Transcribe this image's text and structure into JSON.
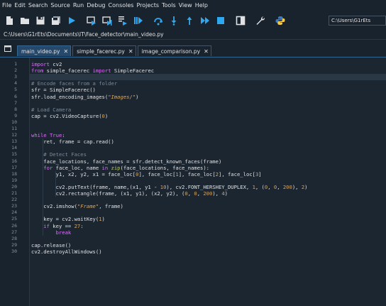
{
  "menu": {
    "items": [
      "File",
      "Edit",
      "Search",
      "Source",
      "Run",
      "Debug",
      "Consoles",
      "Projects",
      "Tools",
      "View",
      "Help"
    ]
  },
  "toolbar": {
    "buttons": [
      {
        "name": "new-file-icon"
      },
      {
        "name": "open-folder-icon"
      },
      {
        "name": "save-icon"
      },
      {
        "name": "save-all-icon"
      },
      {
        "name": "run-icon"
      },
      {
        "name": "run-cell-icon"
      },
      {
        "name": "run-cell-advance-icon"
      },
      {
        "name": "run-selection-icon"
      },
      {
        "name": "debug-icon"
      },
      {
        "name": "step-over-icon"
      },
      {
        "name": "step-into-icon"
      },
      {
        "name": "step-return-icon"
      },
      {
        "name": "continue-icon"
      },
      {
        "name": "stop-icon"
      },
      {
        "name": "maximize-pane-icon"
      },
      {
        "name": "preferences-icon"
      },
      {
        "name": "python-path-icon"
      }
    ],
    "cwd": "C:\\Users\\G1rEts"
  },
  "path": "C:\\Users\\G1rEts\\Documents\\IT\\Face_detector\\main_video.py",
  "tabs": [
    {
      "label": "main_video.py",
      "active": true
    },
    {
      "label": "simple_facerec.py",
      "active": false
    },
    {
      "label": "image_comparison.py",
      "active": false
    }
  ],
  "code": {
    "line_numbers": [
      "1",
      "2",
      "3",
      "4",
      "5",
      "6",
      "7",
      "8",
      "9",
      "10",
      "11",
      "12",
      "13",
      "14",
      "15",
      "16",
      "17",
      "18",
      "19",
      "20",
      "21",
      "22",
      "23",
      "24",
      "25",
      "26",
      "27",
      "28",
      "29",
      "30"
    ],
    "highlight_line": 3,
    "lines": [
      [
        [
          "kw",
          "import"
        ],
        [
          "op",
          " cv2"
        ]
      ],
      [
        [
          "kw",
          "from"
        ],
        [
          "op",
          " simple_facerec "
        ],
        [
          "kw",
          "import"
        ],
        [
          "op",
          " SimpleFacerec"
        ]
      ],
      [],
      [
        [
          "cm",
          "# Encode faces from a folder"
        ]
      ],
      [
        [
          "op",
          "sfr = SimpleFacerec()"
        ]
      ],
      [
        [
          "op",
          "sfr.load_encoding_images("
        ],
        [
          "st",
          "\"Images/\""
        ],
        [
          "op",
          ")"
        ]
      ],
      [],
      [
        [
          "cm",
          "# Load Camera"
        ]
      ],
      [
        [
          "op",
          "cap = cv2.VideoCapture("
        ],
        [
          "nm",
          "0"
        ],
        [
          "op",
          ")"
        ]
      ],
      [],
      [],
      [
        [
          "kw",
          "while"
        ],
        [
          "op",
          " "
        ],
        [
          "kw",
          "True"
        ],
        [
          "op",
          ":"
        ]
      ],
      [
        [
          "op",
          "    ret, frame = cap.read()"
        ]
      ],
      [],
      [
        [
          "cm",
          "    # Detect Faces"
        ]
      ],
      [
        [
          "op",
          "    face_locations, face_names = sfr.detect_known_faces(frame)"
        ]
      ],
      [
        [
          "kw",
          "    for"
        ],
        [
          "op",
          " face_loc, name "
        ],
        [
          "kw",
          "in"
        ],
        [
          "op",
          " "
        ],
        [
          "bi",
          "zip"
        ],
        [
          "op",
          "(face_locations, face_names):"
        ]
      ],
      [
        [
          "op",
          "        y1, x2, y2, x1 = face_loc["
        ],
        [
          "nm",
          "0"
        ],
        [
          "op",
          "], face_loc["
        ],
        [
          "nm",
          "1"
        ],
        [
          "op",
          "], face_loc["
        ],
        [
          "nm",
          "2"
        ],
        [
          "op",
          "], face_loc["
        ],
        [
          "nm",
          "3"
        ],
        [
          "op",
          "]"
        ]
      ],
      [],
      [
        [
          "op",
          "        cv2.putText(frame, name,(x1, y1 - "
        ],
        [
          "nm",
          "10"
        ],
        [
          "op",
          "), cv2.FONT_HERSHEY_DUPLEX, "
        ],
        [
          "nm",
          "1"
        ],
        [
          "op",
          ", ("
        ],
        [
          "nm",
          "0"
        ],
        [
          "op",
          ", "
        ],
        [
          "nm",
          "0"
        ],
        [
          "op",
          ", "
        ],
        [
          "nm",
          "200"
        ],
        [
          "op",
          "), "
        ],
        [
          "nm",
          "2"
        ],
        [
          "op",
          ")"
        ]
      ],
      [
        [
          "op",
          "        cv2.rectangle(frame, (x1, y1), (x2, y2), ("
        ],
        [
          "nm",
          "0"
        ],
        [
          "op",
          ", "
        ],
        [
          "nm",
          "0"
        ],
        [
          "op",
          ", "
        ],
        [
          "nm",
          "200"
        ],
        [
          "op",
          "), "
        ],
        [
          "nm",
          "4"
        ],
        [
          "op",
          ")"
        ]
      ],
      [],
      [
        [
          "op",
          "    cv2.imshow("
        ],
        [
          "st",
          "\"Frame\""
        ],
        [
          "op",
          ", frame)"
        ]
      ],
      [],
      [
        [
          "op",
          "    key = cv2.waitKey("
        ],
        [
          "nm",
          "1"
        ],
        [
          "op",
          ")"
        ]
      ],
      [
        [
          "kw",
          "    if"
        ],
        [
          "op",
          " key == "
        ],
        [
          "nm",
          "27"
        ],
        [
          "op",
          ":"
        ]
      ],
      [
        [
          "kw",
          "        break"
        ]
      ],
      [],
      [
        [
          "op",
          "cap.release()"
        ]
      ],
      [
        [
          "op",
          "cv2.destroyAllWindows()"
        ]
      ]
    ]
  }
}
